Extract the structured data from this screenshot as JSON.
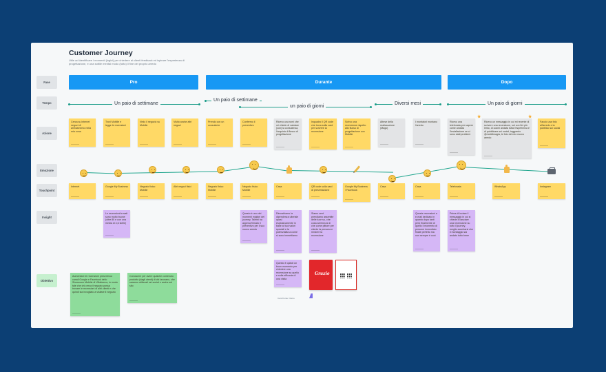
{
  "board": {
    "title": "Customer Journey",
    "subtitle": "Utile ad identificare i momenti (logici) per chiedere ai clienti feedback ed ispirare l'esperienza di progettazione, e una sottile mental modo (tutto) il fine del proprio arredo"
  },
  "rows": {
    "fase": "Fase",
    "tempo": "Tempo",
    "azione": "Azione",
    "emozione": "Emozione",
    "touchpoint": "Touchpoint",
    "insight": "Insight",
    "obiettivo": "Obiettivo"
  },
  "phases": [
    "Pro",
    "Durante",
    "Dopo"
  ],
  "timeline": {
    "pre": "Un paio di settimane",
    "durante_a": "Un paio di settimane",
    "durante_b": "un paio di giorni",
    "durante_c": "Diversi mesi",
    "dopo": "Un paio di giorni"
  },
  "actions": [
    "Cerca su internet negozi di arredamento nella mia zona",
    "Trovi Mobilie e legge le recensioni",
    "Vedo il negozio su Mobilie",
    "Visito anche altri negozi",
    "Prendo con un consulente",
    "Confermo il preventivo",
    "Ricevo una rumi che mi chiede di valutare (con) la consulenza, l'acquisto il flusso di progettazione",
    "Inquadro il QR code che trova sulla card per scrivere la recensione",
    "Scrivo una recensione rispetto allo flusso di progettazione con Mobilie",
    "Attese della realizzazione (Mago)",
    "I montatori montano l'arredo",
    "Ricevo una telefonata per sapere come andata l'installazione se ci sono stati problemi",
    "Ricevo un messaggio in cui mi recente di scrivere una recensione, sul con fini più lento, di cosmi andata tutta l'esperienza e di pubblicare sui social, taggando @mobilimagia, le foto del mio nuovo arredo",
    "Faccio una foto all'arredo e la pubblico sui social"
  ],
  "touchpoints": [
    "Internet",
    "Google My Business",
    "Negozio fisico Mobilie",
    "Altri negozi fisici",
    "Negozio fisico Mobilie",
    "Negozio fisico Mobilie",
    "Casa",
    "QR code sulla card di presentazione",
    "Google My Business / Facebook",
    "Casa",
    "Casa",
    "Telefonata",
    "WhatsApp",
    "Instagram"
  ],
  "insights": [
    "Le recensioni trovati sono molto buone (oltre 80 e con una media di 4,6 stelle)",
    "Questo è uno dei momenti migliori del journey. Talenti ha appena firmato il preventivo per il suo nuovo arredo",
    "Dimostriamo la dipendenza ulteriale quasi esplosivamente in base ai tuoi valori speciali e la potenzialità a come si sono immettiamo",
    "Siamo cent prendiamo assentite delle luce su, che cosa sembra si di che come pittore per cliente la persona e rendere la recensione",
    "Queste recensioni e e-mail dedicato in quanto dopo tanti però finalmente di quello il momento di persone immediato finale perfetto ma non sempre è così",
    "Prima di inviare il messaggio in cui si chiede di lasciare una recensione su tutto il journey, meglio accertarsi che il montaggio sia andato tutto bene"
  ],
  "insight_extra": "Questo è quindi un buon momento per chiedere una recensione su quello e sulla efficacia di una visita",
  "objectives": [
    "Aumentare le recensioni presenti sui canali Google e Facebook dello Showroom Mobilie di Villafranca, in modo tale che chi cerca il negozio possa trovare le recensioni di altri clienti e che quindi sia invogliato a visitare il negozio",
    "Conoscere per avere qualche contenuto prodotto (dagli utenti) di chi lavorano, che saranno utilizzati nei social e anche sul sito"
  ],
  "materials": {
    "card_text": "Grazie",
    "caption": "Card fronte / Retro"
  },
  "colors": {
    "phase": "#1798f4",
    "yellow_note": "#ffd966",
    "grey_note": "#e3e4e6",
    "purple_note": "#d5b7f6",
    "green_note": "#8edc9b",
    "timeline": "#1a9c88"
  }
}
